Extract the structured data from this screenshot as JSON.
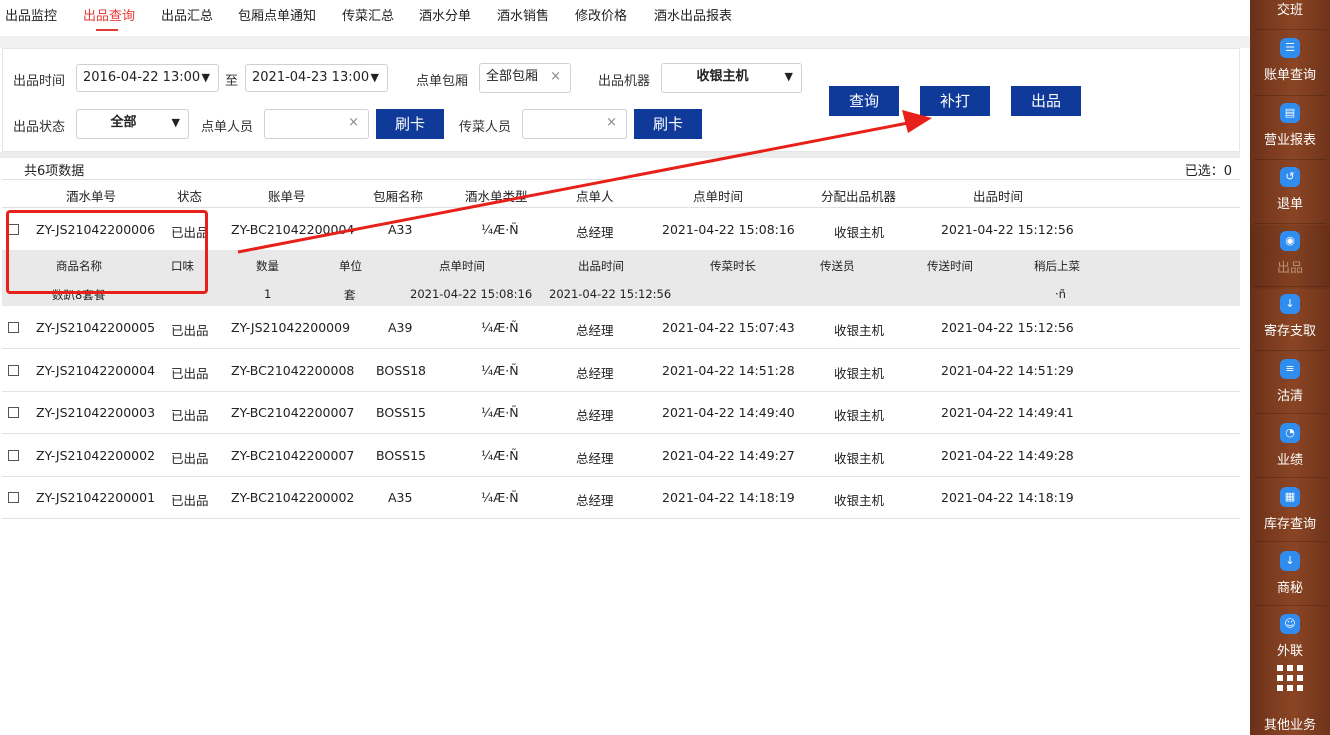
{
  "nav": {
    "tabs": [
      {
        "label": "出品监控"
      },
      {
        "label": "出品查询"
      },
      {
        "label": "出品汇总"
      },
      {
        "label": "包厢点单通知"
      },
      {
        "label": "传菜汇总"
      },
      {
        "label": "酒水分单"
      },
      {
        "label": "酒水销售"
      },
      {
        "label": "修改价格"
      },
      {
        "label": "酒水出品报表"
      }
    ],
    "active_index": 1
  },
  "filter": {
    "time_label": "出品时间",
    "time_start": "2016-04-22 13:00",
    "to_label": "至",
    "time_end": "2021-04-23 13:00",
    "room_label": "点单包厢",
    "room_value": "全部包厢",
    "machine_label": "出品机器",
    "machine_value": "收银主机",
    "status_label": "出品状态",
    "status_value": "全部",
    "orderer_label": "点单人员",
    "orderer_value": "",
    "card1": "刷卡",
    "server_label": "传菜人员",
    "server_value": "",
    "card2": "刷卡",
    "query_btn": "查询",
    "reprint_btn": "补打",
    "out_btn": "出品"
  },
  "summary": {
    "count": "共6项数据",
    "selected": "已选：0"
  },
  "table": {
    "headers": [
      "酒水单号",
      "状态",
      "账单号",
      "包厢名称",
      "酒水单类型",
      "点单人",
      "点单时间",
      "分配出品机器",
      "出品时间"
    ],
    "rows": [
      {
        "no": "ZY-JS21042200006",
        "status": "已出品",
        "bill": "ZY-BC21042200004",
        "room": "A33",
        "type": "¼Æ·Ñ",
        "orderer": "总经理",
        "order_time": "2021-04-22 15:08:16",
        "machine": "收银主机",
        "out_time": "2021-04-22 15:12:56"
      },
      {
        "no": "ZY-JS21042200005",
        "status": "已出品",
        "bill": "ZY-JS21042200009",
        "room": "A39",
        "type": "¼Æ·Ñ",
        "orderer": "总经理",
        "order_time": "2021-04-22 15:07:43",
        "machine": "收银主机",
        "out_time": "2021-04-22 15:12:56"
      },
      {
        "no": "ZY-JS21042200004",
        "status": "已出品",
        "bill": "ZY-BC21042200008",
        "room": "BOSS18",
        "type": "¼Æ·Ñ",
        "orderer": "总经理",
        "order_time": "2021-04-22 14:51:28",
        "machine": "收银主机",
        "out_time": "2021-04-22 14:51:29"
      },
      {
        "no": "ZY-JS21042200003",
        "status": "已出品",
        "bill": "ZY-BC21042200007",
        "room": "BOSS15",
        "type": "¼Æ·Ñ",
        "orderer": "总经理",
        "order_time": "2021-04-22 14:49:40",
        "machine": "收银主机",
        "out_time": "2021-04-22 14:49:41"
      },
      {
        "no": "ZY-JS21042200002",
        "status": "已出品",
        "bill": "ZY-BC21042200007",
        "room": "BOSS15",
        "type": "¼Æ·Ñ",
        "orderer": "总经理",
        "order_time": "2021-04-22 14:49:27",
        "machine": "收银主机",
        "out_time": "2021-04-22 14:49:28"
      },
      {
        "no": "ZY-JS21042200001",
        "status": "已出品",
        "bill": "ZY-BC21042200002",
        "room": "A35",
        "type": "¼Æ·Ñ",
        "orderer": "总经理",
        "order_time": "2021-04-22 14:18:19",
        "machine": "收银主机",
        "out_time": "2021-04-22 14:18:19"
      }
    ],
    "sub_headers": [
      "商品名称",
      "口味",
      "数量",
      "单位",
      "点单时间",
      "出品时间",
      "传菜时长",
      "传送员",
      "传送时间",
      "稍后上菜"
    ],
    "sub_row": {
      "name": "数趴8套餐",
      "flavor": "",
      "qty": "1",
      "unit": "套",
      "order_time": "2021-04-22 15:08:16",
      "out_time": "2021-04-22 15:12:56",
      "later": "·ñ"
    }
  },
  "sidebar": {
    "top": "交班",
    "items": [
      {
        "label": "账单查询",
        "icon": "bill-icon"
      },
      {
        "label": "营业报表",
        "icon": "report-icon"
      },
      {
        "label": "退单",
        "icon": "refund-icon"
      },
      {
        "label": "出品",
        "icon": "dish-icon"
      },
      {
        "label": "寄存支取",
        "icon": "deposit-icon"
      },
      {
        "label": "沽清",
        "icon": "clear-icon"
      },
      {
        "label": "业绩",
        "icon": "pie-icon"
      },
      {
        "label": "库存查询",
        "icon": "stock-icon"
      },
      {
        "label": "商秘",
        "icon": "secretary-icon"
      },
      {
        "label": "外联",
        "icon": "contact-icon"
      }
    ],
    "other": "其他业务"
  },
  "colors": {
    "accent_red": "#e53935",
    "button_blue": "#0f3a9a",
    "annotation_red": "#e8201a",
    "sidebar_brown": "#7e3d20"
  }
}
